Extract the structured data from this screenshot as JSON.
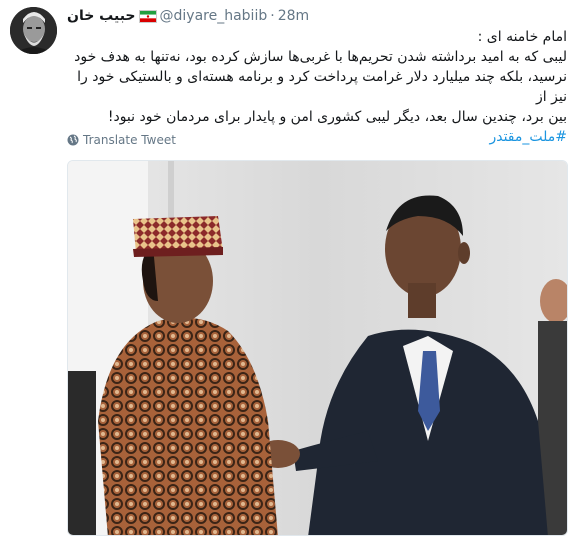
{
  "tweet": {
    "display_name": "حبیب خان",
    "handle": "@diyare_habiib",
    "separator": "·",
    "timestamp": "28m",
    "lines": [
      "امام خامنه ای :",
      "لیبی که به امید برداشته شدن تحریم‌ها با غربی‌ها سازش کرده بود، نه‌تنها به هدف خود",
      "نرسید، بلکه چند میلیارد دلار غرامت پرداخت کرد و برنامه هسته‌ای و بالستیکی خود را نیز از",
      "بین برد، چندین سال بعد، دیگر لیبی کشوری امن و پایدار برای مردمان خود نبود!"
    ],
    "hashtag": "#ملت_مقتدر",
    "translate_label": "Translate Tweet",
    "icons": {
      "avatar": "avatar-photo",
      "flag": "iran-flag-icon",
      "translate": "globe-icon"
    },
    "colors": {
      "link": "#1b95e0",
      "secondary": "#657786"
    }
  }
}
